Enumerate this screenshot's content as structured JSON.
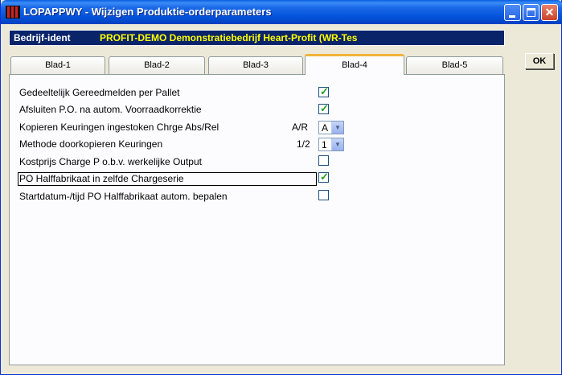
{
  "window": {
    "title": "LOPAPPWY - Wijzigen Produktie-orderparameters",
    "minimize": "_",
    "maximize": "□",
    "close": "✕"
  },
  "header": {
    "company_label": "Bedrijf-ident",
    "company_value": "PROFIT-DEMO Demonstratiebedrijf Heart-Profit (WR-Tes"
  },
  "tabs": [
    {
      "label": "Blad-1",
      "active": false
    },
    {
      "label": "Blad-2",
      "active": false
    },
    {
      "label": "Blad-3",
      "active": false
    },
    {
      "label": "Blad-4",
      "active": true
    },
    {
      "label": "Blad-5",
      "active": false
    }
  ],
  "rows": [
    {
      "label": "Gedeeltelijk Gereedmelden per Pallet",
      "control": "checkbox",
      "checked": true
    },
    {
      "label": "Afsluiten P.O. na autom. Voorraadkorrektie",
      "control": "checkbox",
      "checked": true
    },
    {
      "label": "Kopieren Keuringen ingestoken Chrge Abs/Rel",
      "code": "A/R",
      "control": "select",
      "value": "A"
    },
    {
      "label": "Methode doorkopieren Keuringen",
      "code": "1/2",
      "control": "select",
      "value": "1"
    },
    {
      "label": "Kostprijs Charge P o.b.v. werkelijke Output",
      "control": "checkbox",
      "checked": false
    },
    {
      "label": "PO Halffabrikaat in zelfde Chargeserie",
      "control": "checkbox",
      "checked": true
    },
    {
      "label": "Startdatum-/tijd PO Halffabrikaat autom. bepalen",
      "control": "checkbox",
      "checked": false
    }
  ],
  "ok_button": "OK",
  "icons": {
    "check": "check-icon",
    "dropdown": "chevron-down-icon"
  },
  "colors": {
    "title_bar": "#0452da",
    "header_bg": "#0a246a",
    "header_value": "#ffff00",
    "check": "#21a121"
  }
}
